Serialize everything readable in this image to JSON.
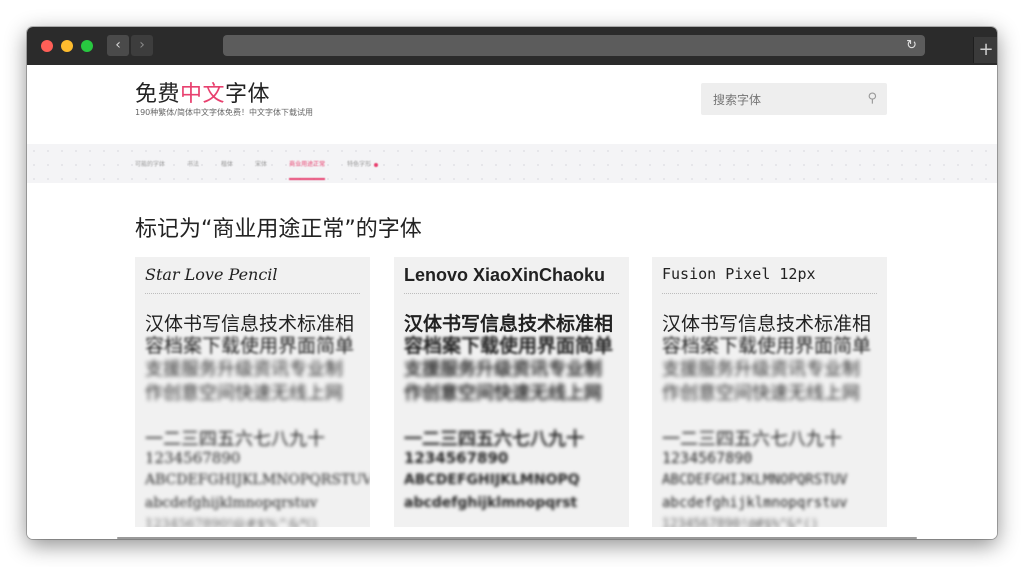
{
  "window": {
    "controls": {
      "close": "close",
      "minimize": "minimize",
      "zoom": "zoom"
    },
    "nav": {
      "back": "‹",
      "forward": "›"
    },
    "reload_glyph": "↻",
    "new_tab_glyph": "+"
  },
  "brand": {
    "title_prefix": "免费",
    "title_accent": "中文",
    "title_suffix": "字体",
    "subtitle": "190种繁体/简体中文字体免费！中文字体下载试用"
  },
  "search": {
    "placeholder": "搜索字体",
    "icon_glyph": "⚲"
  },
  "navstrip": {
    "items": [
      "可能的字体",
      "书法",
      "楷体",
      "宋体",
      "商业用途正常",
      "特色字形"
    ]
  },
  "page_title": "标记为“商业用途正常”的字体",
  "cards": [
    {
      "name": "Star Love Pencil",
      "hanzi_1": "汉体书写信息技术标准相",
      "hanzi_2": "容档案下载使用界面简单",
      "hanzi_3": "支援服务升级资讯专业制",
      "hanzi_4": "作创意空间快速无线上网",
      "nums_cn": "一二三四五六七八九十",
      "digits": "1234567890",
      "upper": "ABCDEFGHIJKLMNOPQRSTUV",
      "lower": "abcdefghijklmnopqrstuv",
      "tail": "1234567890!@#$%^&*()"
    },
    {
      "name": "Lenovo XiaoXinChaoku",
      "hanzi_1": "汉体书写信息技术标准相",
      "hanzi_2": "容档案下载使用界面简单",
      "hanzi_3": "支援服务升级资讯专业制",
      "hanzi_4": "作创意空间快速无线上网",
      "nums_cn": "一二三四五六七八九十",
      "digits": "1234567890",
      "upper": "ABCDEFGHIJKLMNOPQ",
      "lower": "abcdefghijklmnopqrst",
      "tail": ""
    },
    {
      "name": "Fusion Pixel 12px",
      "hanzi_1": "汉体书写信息技术标准相",
      "hanzi_2": "容档案下载使用界面简单",
      "hanzi_3": "支援服务升级资讯专业制",
      "hanzi_4": "作创意空间快速无线上网",
      "nums_cn": "一二三四五六七八九十",
      "digits": "1234567890",
      "upper": "ABCDEFGHIJKLMNOPQRSTUV",
      "lower": "abcdefghijklmnopqrstuv",
      "tail": "1234567890!@#$%^&*()"
    }
  ],
  "colors": {
    "accent": "#e8416f",
    "titlebar": "#2b2b2b",
    "card_bg": "#f1f1f1"
  }
}
